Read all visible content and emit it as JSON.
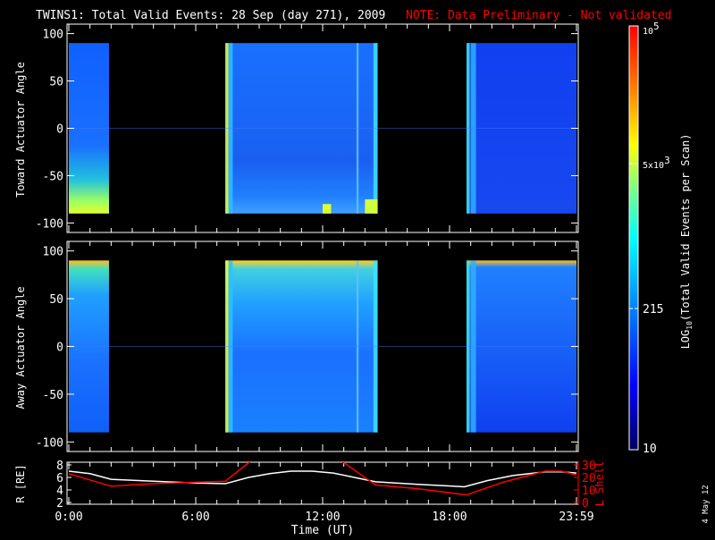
{
  "title": {
    "main": "TWINS1: Total Valid Events: 28 Sep (day 271), 2009",
    "note": "NOTE: Data Preliminary - Not validated",
    "note_color": "#ff0000"
  },
  "date_stamp": "4 May 12",
  "chart_data": [
    {
      "type": "heatmap",
      "name": "toward",
      "ylabel": "Toward Actuator Angle",
      "ylim": [
        -110,
        110
      ],
      "yticks": [
        "100",
        "50",
        "0",
        "-50",
        "-100"
      ],
      "ytick_values": [
        100,
        50,
        0,
        -50,
        -100
      ],
      "angle_range": [
        -90,
        90
      ],
      "data_intervals_hours": [
        [
          0,
          1.9
        ],
        [
          7.4,
          14.6
        ],
        [
          18.8,
          24
        ]
      ]
    },
    {
      "type": "heatmap",
      "name": "away",
      "ylabel": "Away Actuator Angle",
      "ylim": [
        -110,
        110
      ],
      "yticks": [
        "100",
        "50",
        "0",
        "-50",
        "-100"
      ],
      "ytick_values": [
        100,
        50,
        0,
        -50,
        -100
      ],
      "angle_range": [
        -90,
        90
      ],
      "data_intervals_hours": [
        [
          0,
          1.9
        ],
        [
          7.4,
          14.6
        ],
        [
          18.8,
          24
        ]
      ]
    },
    {
      "type": "line",
      "name": "orbit",
      "xlabel": "Time (UT)",
      "xticks": [
        "0:00",
        "6:00",
        "12:00",
        "18:00",
        "23:59"
      ],
      "xtick_values": [
        0,
        6,
        12,
        18,
        24
      ],
      "ylabel_left": "R [RE]",
      "ylim_left": [
        2,
        8
      ],
      "yticks_left": [
        "8",
        "6",
        "4",
        "2"
      ],
      "ylabel_right": "L Shell",
      "ylim_right": [
        0,
        30
      ],
      "yticks_right": [
        "30",
        "20",
        "10",
        "0"
      ],
      "series": [
        {
          "name": "R",
          "color": "#ffffff",
          "x": [
            0,
            1,
            2,
            4,
            6,
            7.4,
            8.5,
            9.5,
            10.5,
            11.5,
            12.5,
            13.5,
            14.5,
            16.5,
            18.7,
            19.8,
            21,
            22.5,
            23.3,
            24
          ],
          "y": [
            7.0,
            6.6,
            5.7,
            5.4,
            5.1,
            5.0,
            6.0,
            6.6,
            7.0,
            7.0,
            6.7,
            6.0,
            5.3,
            4.9,
            4.5,
            5.5,
            6.3,
            6.9,
            6.9,
            6.7
          ]
        },
        {
          "name": "L Shell",
          "color": "#ff0000",
          "x": [
            0,
            2,
            4,
            7.4,
            8.6,
            12.9,
            14.5,
            16.5,
            18.8,
            20.5,
            22.5,
            23.3,
            24
          ],
          "y": [
            23,
            13,
            15,
            17,
            33,
            33,
            14,
            11,
            6,
            16,
            25,
            25,
            22
          ]
        }
      ]
    }
  ],
  "colorbar": {
    "label": "LOG10(Total Valid Events per Scan)",
    "label_main": "LOG",
    "label_sub": "10",
    "label_rest": "(Total Valid Events per Scan)",
    "ticks": [
      {
        "label": "10",
        "value": 10
      },
      {
        "label": "215",
        "value": 215
      },
      {
        "label": "5x10",
        "sup": "3",
        "value": 5000
      },
      {
        "label": "10",
        "sup": "5",
        "value": 100000
      }
    ]
  }
}
